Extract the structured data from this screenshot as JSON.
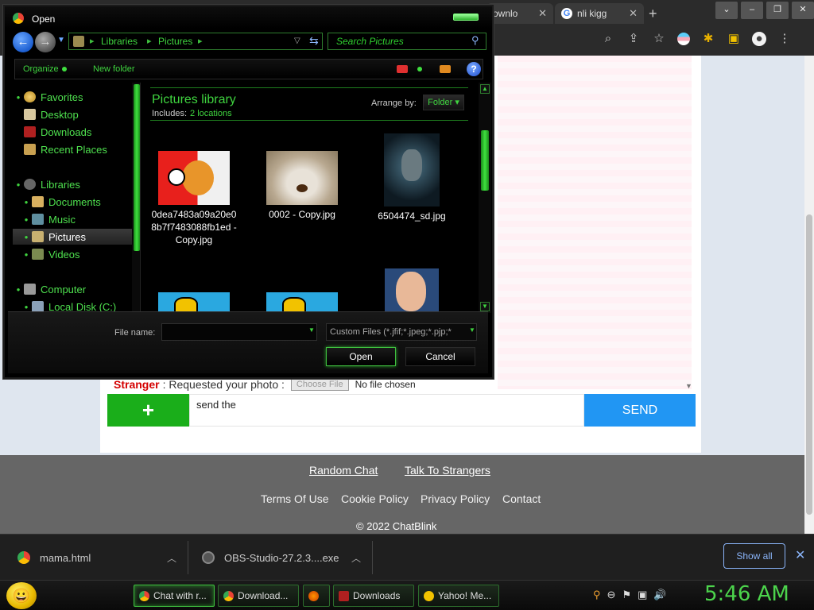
{
  "browser": {
    "tabs": [
      {
        "label": "ownlo"
      },
      {
        "label": "nli kigg"
      }
    ],
    "new_tab": "+",
    "window_controls": [
      "⌄",
      "–",
      "❐",
      "✕"
    ],
    "toolbar_icons": [
      "zoom-icon",
      "share-icon",
      "star-icon",
      "flag-avatar-icon",
      "puzzle-icon",
      "sidebar-icon",
      "profile-icon",
      "menu-icon"
    ]
  },
  "page": {
    "stranger_label": "Stranger",
    "stranger_message": ": Requested your photo :",
    "choose_file_label": "Choose File",
    "no_file_chosen": "No file chosen",
    "plus_label": "+",
    "message_value": "send the",
    "send_label": "SEND"
  },
  "footer": {
    "top_links": [
      "Random Chat",
      "Talk To Strangers"
    ],
    "links": [
      "Terms Of Use",
      "Cookie Policy",
      "Privacy Policy",
      "Contact"
    ],
    "copyright": "© 2022 ChatBlink"
  },
  "downloads": {
    "items": [
      {
        "name": "mama.html"
      },
      {
        "name": "OBS-Studio-27.2.3....exe"
      }
    ],
    "show_all": "Show all",
    "close": "✕"
  },
  "taskbar": {
    "buttons": [
      {
        "label": "Chat with r..."
      },
      {
        "label": "Download..."
      },
      {
        "label": ""
      },
      {
        "label": "Downloads"
      },
      {
        "label": "Yahoo! Me..."
      }
    ],
    "clock": "5:46 AM"
  },
  "dialog": {
    "title": "Open",
    "breadcrumb": [
      "Libraries",
      "Pictures"
    ],
    "search_placeholder": "Search Pictures",
    "organize": "Organize",
    "new_folder": "New folder",
    "help": "?",
    "nav": {
      "favorites": "Favorites",
      "desktop": "Desktop",
      "downloads": "Downloads",
      "recent": "Recent Places",
      "libraries": "Libraries",
      "documents": "Documents",
      "music": "Music",
      "pictures": "Pictures",
      "videos": "Videos",
      "computer": "Computer",
      "localdisk": "Local Disk (C:)"
    },
    "library_title": "Pictures library",
    "includes_label": "Includes:",
    "includes_value": "2 locations",
    "arrange_label": "Arrange by:",
    "arrange_value": "Folder",
    "files": [
      {
        "name": "0dea7483a09a20e08b7f7483088fb1ed - Copy.jpg"
      },
      {
        "name": "0002 - Copy.jpg"
      },
      {
        "name": "6504474_sd.jpg"
      }
    ],
    "file_name_label": "File name:",
    "file_name_value": "",
    "filter": "Custom Files (*.jfif;*.jpeg;*.pjp;*",
    "open_label": "Open",
    "cancel_label": "Cancel"
  }
}
